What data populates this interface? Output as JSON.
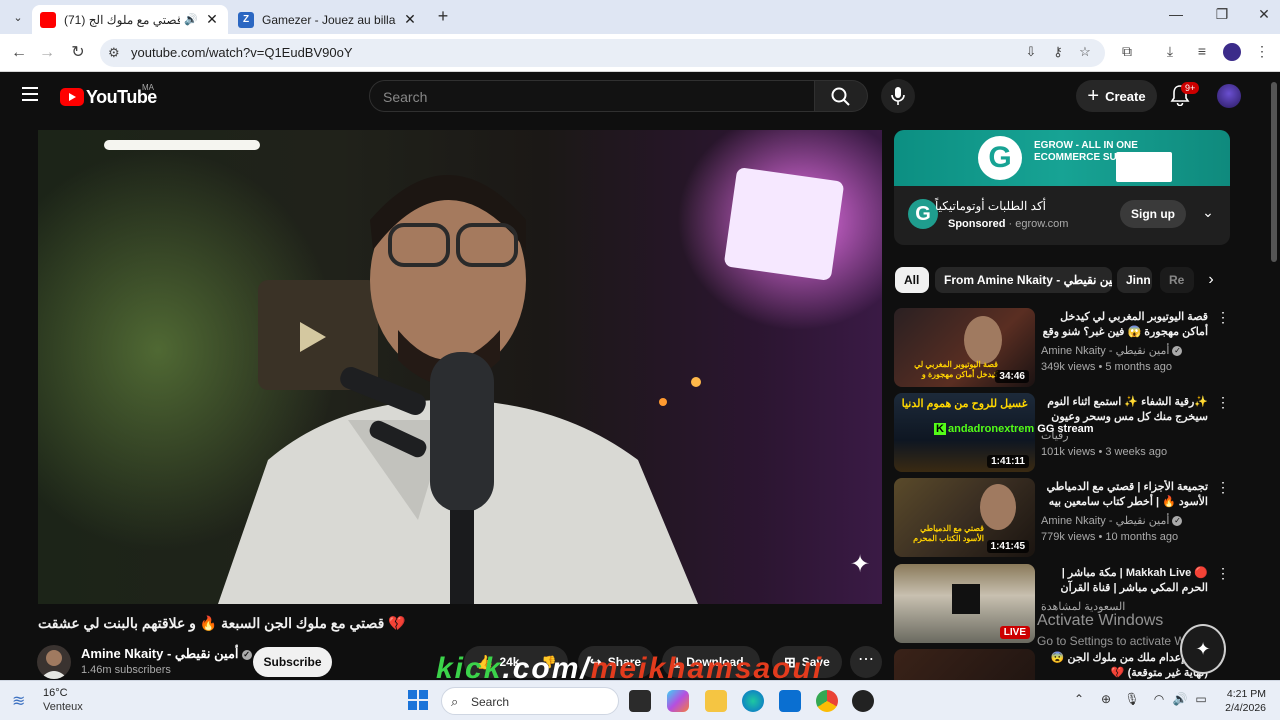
{
  "browser": {
    "tabs": [
      {
        "title": "(71) قصتي مع ملوك الج...",
        "active": true,
        "favicon": "youtube-icon"
      },
      {
        "title": "Gamezer - Jouez au billard, aux",
        "active": false,
        "favicon": "gamezer-icon"
      }
    ],
    "url": "youtube.com/watch?v=Q1EudBV90oY"
  },
  "youtube": {
    "logo_text": "YouTube",
    "country_code": "MA",
    "search_placeholder": "Search",
    "create_label": "Create",
    "notifications_badge": "9+"
  },
  "video": {
    "title": "💔 قصتي مع ملوك الجن السبعة 🔥 و علاقتهم بالبنت لي عشقت",
    "channel_name": "Amine Nkaity - أمين نقيطي",
    "subscribers": "1.46m subscribers",
    "subscribe_label": "Subscribe",
    "actions": {
      "likes": "24k",
      "share": "Share",
      "download": "Download",
      "save": "Save"
    }
  },
  "ad": {
    "banner_text": "EGROW - ALL IN ONE ECOMMERCE SUITE",
    "title": "أكد الطلبات أوتوماتيكياً",
    "sponsored": "Sponsored",
    "domain": "egrow.com",
    "cta": "Sign up"
  },
  "chips": [
    "All",
    "From Amine Nkaity - أمين نقيطي",
    "Jinn",
    "Re"
  ],
  "recommendations": [
    {
      "title": "قصة اليوتيوبر المغربي لي كيدخل أماكن مهجورة 😱 فين غبر؟ شنو وقع ليه؟😨 |",
      "channel": "Amine Nkaity - أمين نقيطي",
      "meta": "349k views • 5 months ago",
      "duration": "34:46",
      "thumb_text": "قصة اليوتيوبر المغربي لي كيدخل أماكن مهجورة و مسكونة😱"
    },
    {
      "title": "✨رقية الشفاء ✨ استمع اثناء النوم سيخرج منك كل مس وسحر وعيون قديمة من جسمك",
      "channel": "رقيات",
      "meta": "101k views • 3 weeks ago",
      "duration": "1:41:11",
      "thumb_text": "غسيل للروح من هموم الدنيا"
    },
    {
      "title": "تجميعة الأجزاء | قصتي مع الدمياطي الأسود 🔥 | أخطر كتاب سامعين بيه و ماعارفين",
      "channel": "Amine Nkaity - أمين نقيطي",
      "meta": "779k views • 10 months ago",
      "duration": "1:41:45",
      "thumb_text": "قصتي مع الدمياطي الأسود الكتاب المحرم"
    },
    {
      "title": "🔴 Makkah Live | مكة مباشر | الحرم المكي مباشر | قناة القرآن الكريم السعودية",
      "channel": "السعودية لمشاهدة",
      "meta": "",
      "live": "LIVE"
    },
    {
      "title": "قصة إعدام ملك من ملوك الجن 😨 (نهاية غير متوقعة) 💔",
      "channel": "",
      "meta": ""
    }
  ],
  "overlays": {
    "activate_title": "Activate Windows",
    "activate_sub": "Go to Settings to activate Windows.",
    "kick_watermark": [
      "kick",
      ".com/",
      "meikhamsaoui"
    ],
    "kick_stream": [
      "andadronextrem",
      "GG stream"
    ]
  },
  "taskbar": {
    "weather_temp": "16°C",
    "weather_desc": "Venteux",
    "search_label": "Search",
    "time": "4:21 PM",
    "date": "2/4/2026"
  }
}
